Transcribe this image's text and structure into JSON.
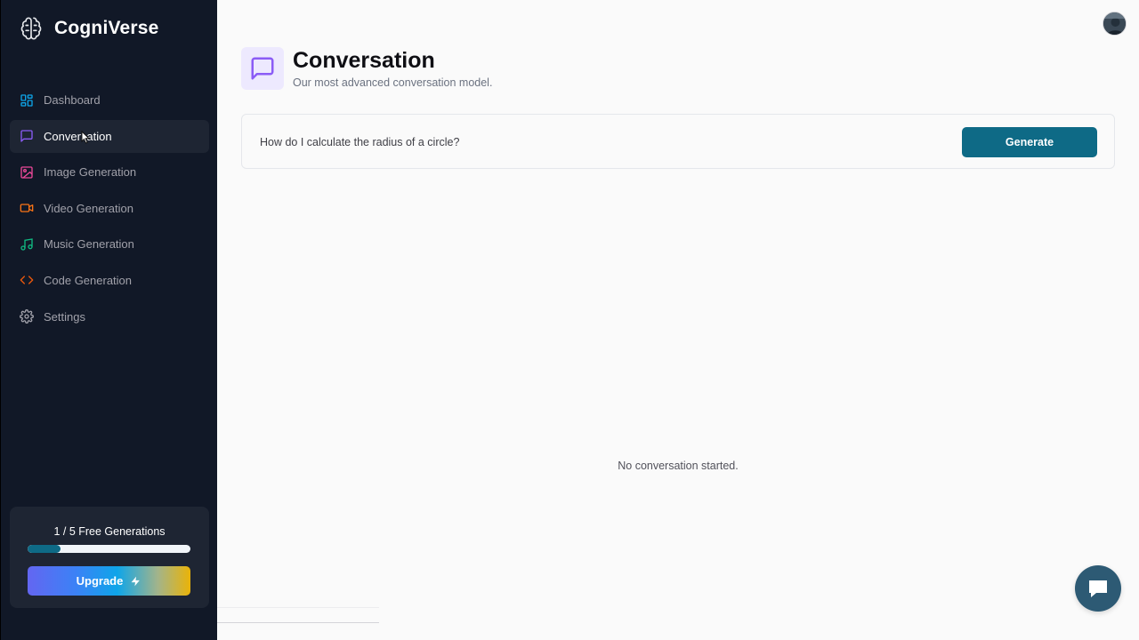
{
  "brand": {
    "name": "CogniVerse",
    "logo_icon": "brain-icon"
  },
  "sidebar": {
    "items": [
      {
        "label": "Dashboard",
        "icon": "dashboard-grid-icon",
        "color": "#0ea5e9",
        "active": false
      },
      {
        "label": "Conversation",
        "icon": "message-square-icon",
        "color": "#8b5cf6",
        "active": true
      },
      {
        "label": "Image Generation",
        "icon": "image-icon",
        "color": "#ec4899",
        "active": false
      },
      {
        "label": "Video Generation",
        "icon": "video-icon",
        "color": "#f97316",
        "active": false
      },
      {
        "label": "Music Generation",
        "icon": "music-icon",
        "color": "#10b981",
        "active": false
      },
      {
        "label": "Code Generation",
        "icon": "code-icon",
        "color": "#ea580c",
        "active": false
      },
      {
        "label": "Settings",
        "icon": "gear-icon",
        "color": "#a1a1aa",
        "active": false
      }
    ],
    "free_generations": {
      "text": "1 / 5 Free Generations",
      "progress_fraction": 0.2
    },
    "upgrade": {
      "label": "Upgrade",
      "icon": "zap-icon"
    }
  },
  "header": {
    "avatar_icon": "user-avatar"
  },
  "page": {
    "title": "Conversation",
    "subtitle": "Our most advanced conversation model.",
    "icon": "message-square-icon",
    "accent_color": "#8b5cf6"
  },
  "prompt": {
    "value": "How do I calculate the radius of a circle?",
    "generate_label": "Generate",
    "button_color": "#0e6a86"
  },
  "conversation": {
    "empty_message": "No conversation started."
  },
  "chat_widget": {
    "icon": "chat-bubble-icon",
    "color": "#2d5a74"
  }
}
